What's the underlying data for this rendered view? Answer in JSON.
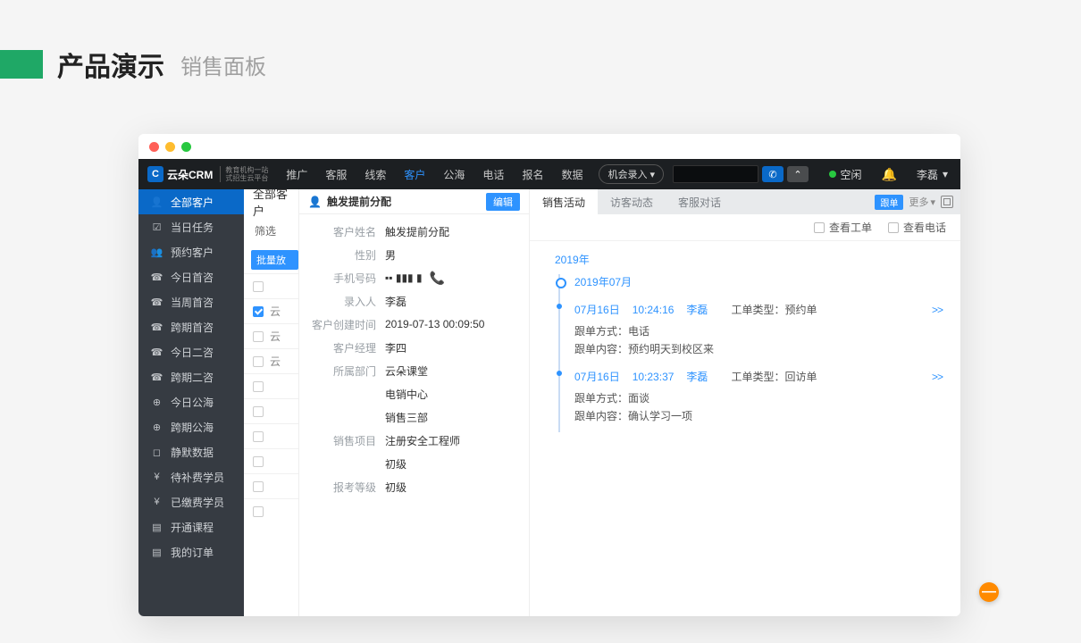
{
  "slide": {
    "title": "产品演示",
    "subtitle": "销售面板"
  },
  "topbar": {
    "brand": "云朵CRM",
    "brand_sub1": "教育机构一站",
    "brand_sub2": "式招生云平台",
    "nav": [
      "推广",
      "客服",
      "线索",
      "客户",
      "公海",
      "电话",
      "报名",
      "数据"
    ],
    "nav_active_index": 3,
    "opportunity_btn": "机会录入",
    "status_label": "空闲",
    "user_name": "李磊"
  },
  "sidebar": {
    "items": [
      {
        "icon": "👤",
        "label": "全部客户"
      },
      {
        "icon": "☑",
        "label": "当日任务"
      },
      {
        "icon": "👥",
        "label": "预约客户"
      },
      {
        "icon": "☎",
        "label": "今日首咨"
      },
      {
        "icon": "☎",
        "label": "当周首咨"
      },
      {
        "icon": "☎",
        "label": "跨期首咨"
      },
      {
        "icon": "☎",
        "label": "今日二咨"
      },
      {
        "icon": "☎",
        "label": "跨期二咨"
      },
      {
        "icon": "⊕",
        "label": "今日公海"
      },
      {
        "icon": "⊕",
        "label": "跨期公海"
      },
      {
        "icon": "◻",
        "label": "静默数据"
      },
      {
        "icon": "¥",
        "label": "待补费学员"
      },
      {
        "icon": "¥",
        "label": "已缴费学员"
      },
      {
        "icon": "▤",
        "label": "开通课程"
      },
      {
        "icon": "▤",
        "label": "我的订单"
      }
    ],
    "active_index": 0
  },
  "list": {
    "title": "全部客户",
    "filter_label": "筛选",
    "batch_label": "批量放",
    "rows": [
      {
        "text": "",
        "sel": false
      },
      {
        "text": "云",
        "sel": true
      },
      {
        "text": "云",
        "sel": false
      },
      {
        "text": "云",
        "sel": false
      },
      {
        "text": "",
        "sel": false
      },
      {
        "text": "",
        "sel": false
      },
      {
        "text": "",
        "sel": false
      },
      {
        "text": "",
        "sel": false
      },
      {
        "text": "",
        "sel": false
      },
      {
        "text": "",
        "sel": false
      }
    ]
  },
  "detail": {
    "header_title": "触发提前分配",
    "edit_label": "编辑",
    "fields": [
      {
        "label": "客户姓名",
        "value": "触发提前分配"
      },
      {
        "label": "性别",
        "value": "男"
      },
      {
        "label": "手机号码",
        "value": "▪▪  ▮▮▮ ▮",
        "phone": true
      },
      {
        "label": "录入人",
        "value": "李磊"
      },
      {
        "label": "客户创建时间",
        "value": "2019-07-13 00:09:50"
      },
      {
        "label": "客户经理",
        "value": "李四"
      },
      {
        "label": "所属部门",
        "value": "云朵课堂"
      },
      {
        "label": "",
        "value": "电销中心"
      },
      {
        "label": "",
        "value": "销售三部"
      },
      {
        "label": "销售项目",
        "value": "注册安全工程师"
      },
      {
        "label": "",
        "value": "初级"
      },
      {
        "label": "报考等级",
        "value": "初级"
      }
    ]
  },
  "activity": {
    "tabs": [
      "销售活动",
      "访客动态",
      "客服对话"
    ],
    "active_tab": 0,
    "follow_tag": "跟单",
    "more_label": "更多",
    "filter_ticket": "查看工单",
    "filter_call": "查看电话",
    "year": "2019年",
    "month": "2019年07月",
    "entries": [
      {
        "date": "07月16日",
        "time": "10:24:16",
        "who": "李磊",
        "type_label": "工单类型：",
        "type_value": "预约单",
        "method_label": "跟单方式：",
        "method_value": "电话",
        "content_label": "跟单内容：",
        "content_value": "预约明天到校区来"
      },
      {
        "date": "07月16日",
        "time": "10:23:37",
        "who": "李磊",
        "type_label": "工单类型：",
        "type_value": "回访单",
        "method_label": "跟单方式：",
        "method_value": "面谈",
        "content_label": "跟单内容：",
        "content_value": "确认学习一项"
      }
    ]
  }
}
